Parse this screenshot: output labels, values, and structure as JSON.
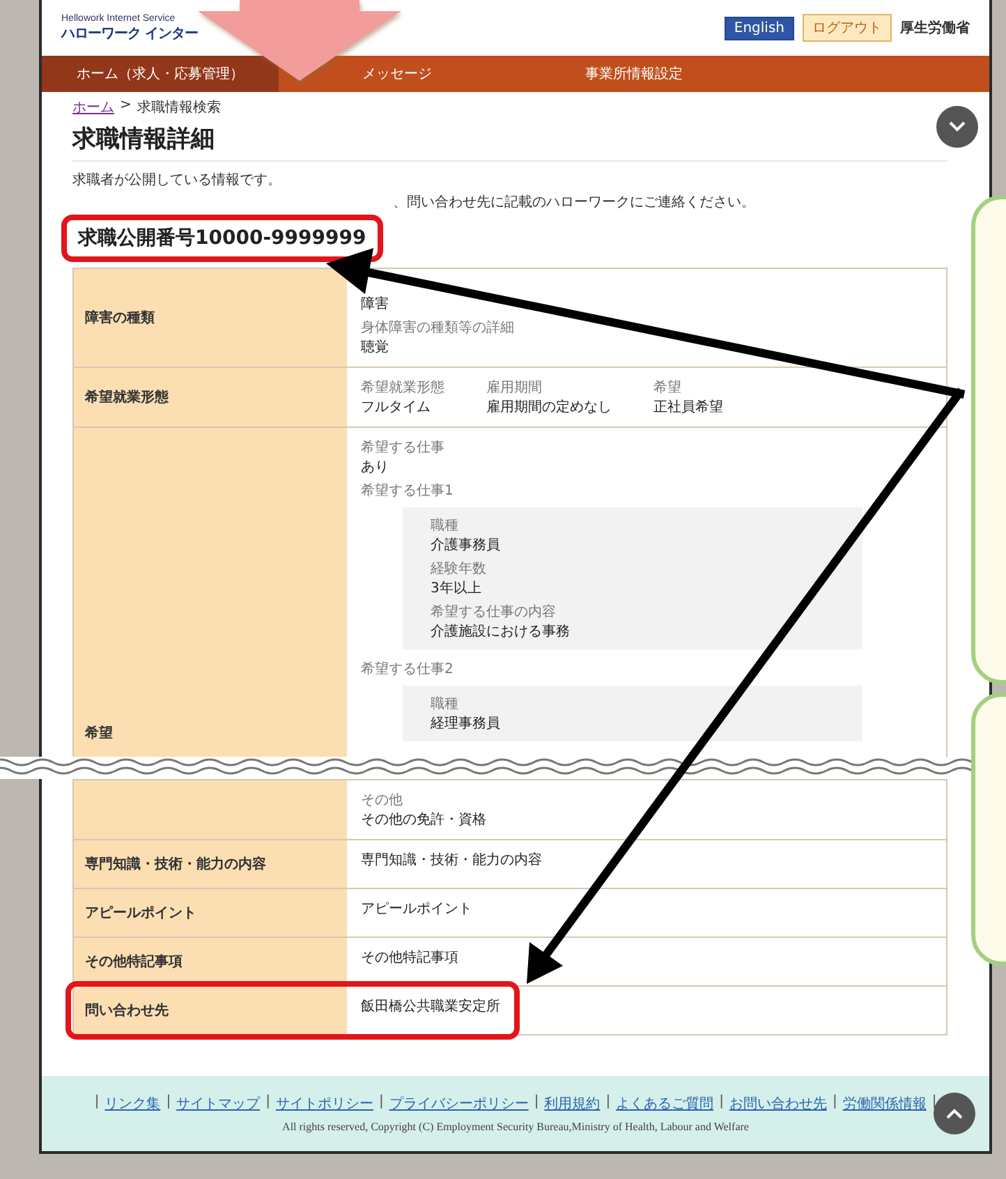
{
  "header": {
    "subtitle": "Hellowork Internet Service",
    "logo": "ハローワーク インター",
    "buttons": [
      {
        "label": "English",
        "kind": "language"
      },
      {
        "label": "ログアウト",
        "kind": "logout"
      }
    ],
    "ministry": "厚生労働省"
  },
  "nav": [
    {
      "label": "ホーム（求人・応募管理）",
      "selected": true
    },
    {
      "label": "メッセージ",
      "selected": false
    },
    {
      "label": "事業所情報設定",
      "selected": false
    }
  ],
  "breadcrumb": {
    "items": [
      {
        "label": "ホーム",
        "link": true
      },
      {
        "label": "求職情報検索",
        "link": false
      }
    ],
    "separator": ">"
  },
  "page_title": "求職情報詳細",
  "notes": [
    "求職者が公開している情報です。",
    "、問い合わせ先に記載のハローワークにご連絡ください。"
  ],
  "job_number": {
    "text": "求職公開番号10000-9999999",
    "highlighted": true
  },
  "rows": [
    {
      "label": "障害の種類",
      "highlighted": false,
      "kind": "stack",
      "fields": [
        {
          "value": "障害"
        },
        {
          "caption": "身体障害の種類等の詳細",
          "value": "聴覚"
        }
      ]
    },
    {
      "label": "希望就業形態",
      "highlighted": false,
      "kind": "columns",
      "fields": [
        {
          "caption": "希望就業形態",
          "value": "フルタイム"
        },
        {
          "caption": "雇用期間",
          "value": "雇用期間の定めなし"
        },
        {
          "caption": "希望",
          "value": "正社員希望"
        }
      ]
    },
    {
      "label": "希望",
      "highlighted": false,
      "kind": "stack",
      "fields": [
        {
          "caption": "希望する仕事",
          "value": "あり"
        }
      ],
      "groups": [
        {
          "caption": "希望する仕事1",
          "fields": [
            {
              "caption": "職種",
              "value": "介護事務員"
            },
            {
              "caption": "経験年数",
              "value": "3年以上"
            },
            {
              "caption": "希望する仕事の内容",
              "value": "介護施設における事務"
            }
          ]
        },
        {
          "caption": "希望する仕事2",
          "fields": [
            {
              "caption": "職種",
              "value": "経理事務員"
            }
          ]
        }
      ],
      "break_after": true
    },
    {
      "highlighted": false,
      "kind": "stack",
      "fields": [
        {
          "caption": "その他",
          "value": "その他の免許・資格"
        }
      ]
    },
    {
      "label": "専門知識・技術・能力の内容",
      "highlighted": false,
      "kind": "stack",
      "fields": [
        {
          "value": "専門知識・技術・能力の内容"
        }
      ]
    },
    {
      "label": "アピールポイント",
      "highlighted": false,
      "kind": "stack",
      "fields": [
        {
          "value": "アピールポイント"
        }
      ]
    },
    {
      "label": "その他特記事項",
      "highlighted": false,
      "kind": "stack",
      "fields": [
        {
          "value": "その他特記事項"
        }
      ]
    },
    {
      "label": "問い合わせ先",
      "highlighted": true,
      "kind": "stack",
      "fields": [
        {
          "value": "飯田橋公共職業安定所"
        }
      ]
    }
  ],
  "footer": {
    "links": [
      "リンク集",
      "サイトマップ",
      "サイトポリシー",
      "プライバシーポリシー",
      "利用規約",
      "よくあるご質問",
      "お問い合わせ先",
      "労働関係情報"
    ],
    "separator": "|",
    "copyright": "All rights reserved, Copyright (C) Employment Security Bureau,Ministry of Health, Labour and Welfare"
  }
}
